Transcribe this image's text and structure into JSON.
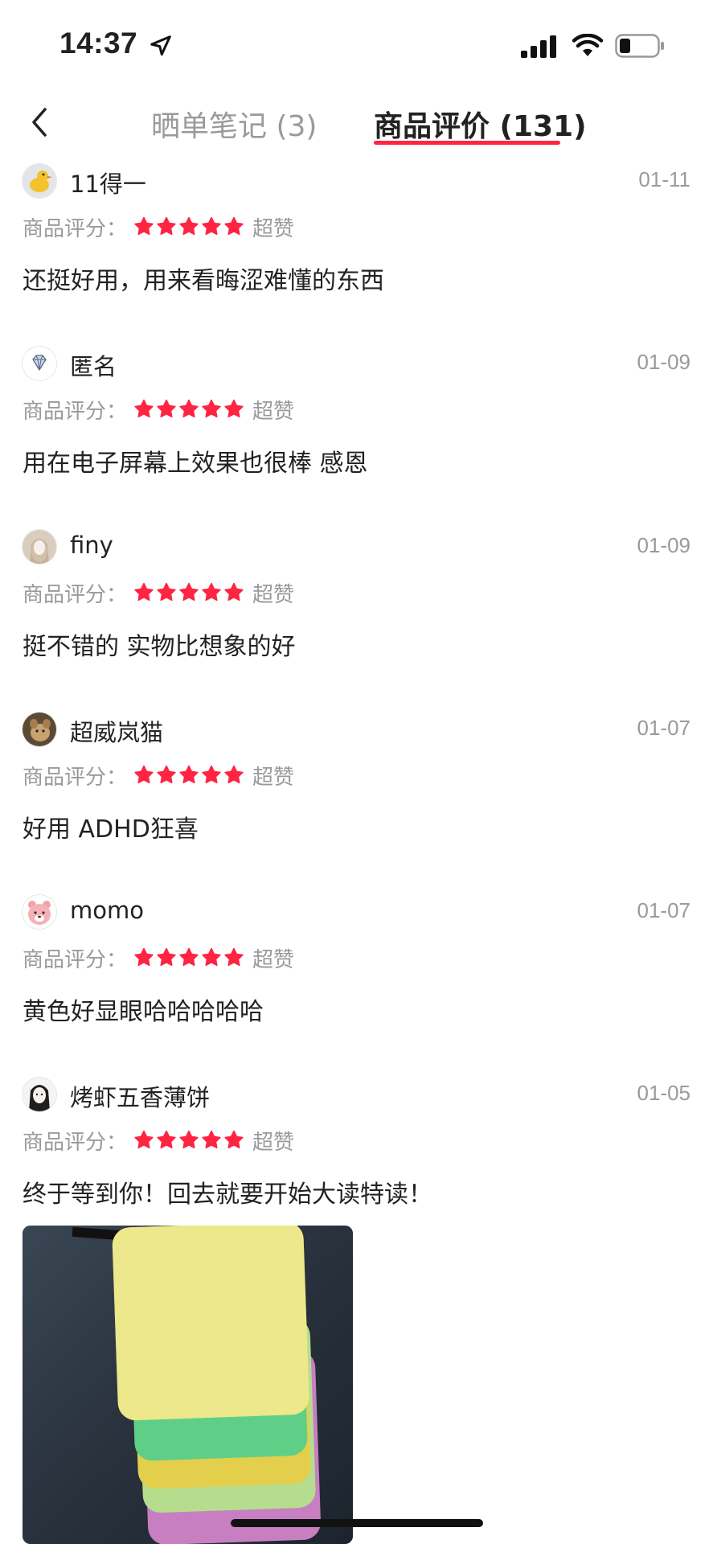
{
  "status_bar": {
    "time": "14:37"
  },
  "tabs": [
    {
      "label": "晒单笔记 (3)",
      "active": false
    },
    {
      "label": "商品评价 (131)",
      "active": true
    }
  ],
  "rating_label": "商品评分：",
  "reviews": [
    {
      "user": "11得一",
      "date": "01-11",
      "stars": 5,
      "rating_text": "超赞",
      "content": "还挺好用，用来看晦涩难懂的东西"
    },
    {
      "user": "匿名",
      "date": "01-09",
      "stars": 5,
      "rating_text": "超赞",
      "content": "用在电子屏幕上效果也很棒 感恩"
    },
    {
      "user": "finy",
      "date": "01-09",
      "stars": 5,
      "rating_text": "超赞",
      "content": "挺不错的 实物比想象的好"
    },
    {
      "user": "超威岚猫",
      "date": "01-07",
      "stars": 5,
      "rating_text": "超赞",
      "content": "好用 ADHD狂喜"
    },
    {
      "user": "momo",
      "date": "01-07",
      "stars": 5,
      "rating_text": "超赞",
      "content": "黄色好显眼哈哈哈哈哈"
    },
    {
      "user": "烤虾五香薄饼",
      "date": "01-05",
      "stars": 5,
      "rating_text": "超赞",
      "content": "终于等到你！回去就要开始大读特读！"
    }
  ],
  "colors": {
    "accent": "#ff2442",
    "muted": "#9a9a9a",
    "text": "#222222"
  }
}
